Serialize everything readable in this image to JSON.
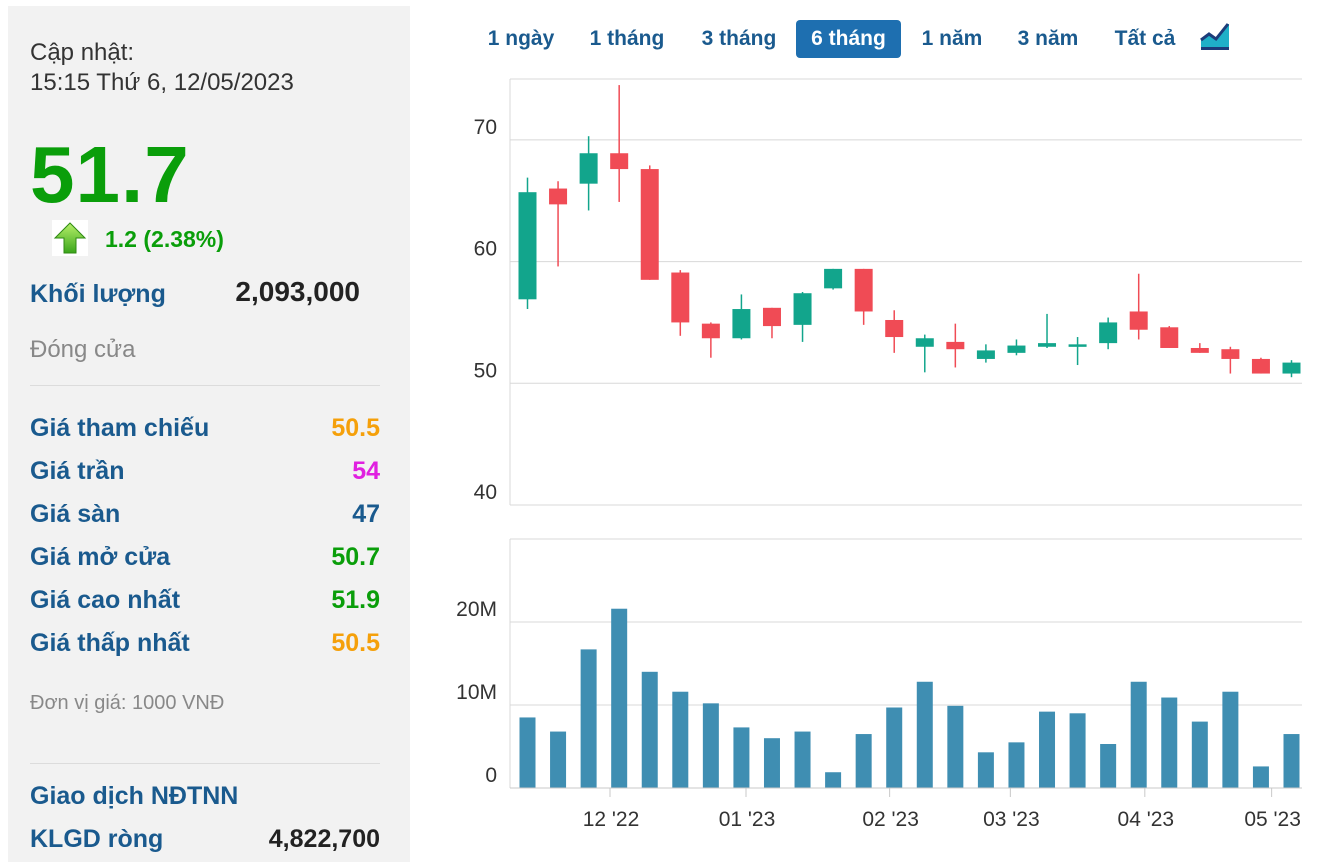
{
  "panel": {
    "updated_label": "Cập nhật:",
    "updated_time": "15:15 Thứ 6, 12/05/2023",
    "price": "51.7",
    "change": "1.2 (2.38%)",
    "volume_label": "Khối lượng",
    "volume_value": "2,093,000",
    "status": "Đóng cửa",
    "rows": [
      {
        "label": "Giá tham chiếu",
        "value": "50.5",
        "color": "#f5a00a"
      },
      {
        "label": "Giá trần",
        "value": "54",
        "color": "#e020e0"
      },
      {
        "label": "Giá sàn",
        "value": "47",
        "color": "#1a5a8e"
      },
      {
        "label": "Giá mở cửa",
        "value": "50.7",
        "color": "#0a9e0a"
      },
      {
        "label": "Giá cao nhất",
        "value": "51.9",
        "color": "#0a9e0a"
      },
      {
        "label": "Giá thấp nhất",
        "value": "50.5",
        "color": "#f5a00a"
      }
    ],
    "unit_note": "Đơn vị giá: 1000 VNĐ",
    "foreign_title": "Giao dịch NĐTNN",
    "net_label": "KLGD ròng",
    "net_value": "4,822,700"
  },
  "tabs": {
    "items": [
      "1 ngày",
      "1 tháng",
      "3 tháng",
      "6 tháng",
      "1 năm",
      "3 năm",
      "Tất cả"
    ],
    "active": "6 tháng",
    "chart_type_icon": "area-chart-icon"
  },
  "colors": {
    "up": "#12a58c",
    "down": "#f04b55",
    "volume": "#3f8eb2",
    "accent": "#1e6fb0"
  },
  "chart_data": [
    {
      "type": "candlestick",
      "ylim": [
        40,
        75
      ],
      "yticks": [
        40,
        50,
        60,
        70
      ],
      "x_ticks": [
        {
          "label": "12 '22",
          "index": 2.7
        },
        {
          "label": "01 '23",
          "index": 7.15
        },
        {
          "label": "02 '23",
          "index": 11.85
        },
        {
          "label": "03 '23",
          "index": 15.8
        },
        {
          "label": "04 '23",
          "index": 20.2
        },
        {
          "label": "05 '23",
          "index": 24.35
        }
      ],
      "candles": [
        {
          "o": 56.9,
          "h": 66.9,
          "l": 56.1,
          "c": 65.7
        },
        {
          "o": 66.0,
          "h": 66.6,
          "l": 59.6,
          "c": 64.7
        },
        {
          "o": 66.4,
          "h": 70.3,
          "l": 64.2,
          "c": 68.9
        },
        {
          "o": 68.9,
          "h": 74.5,
          "l": 64.9,
          "c": 67.6
        },
        {
          "o": 67.6,
          "h": 67.9,
          "l": 58.5,
          "c": 58.5
        },
        {
          "o": 59.1,
          "h": 59.3,
          "l": 53.9,
          "c": 55.0
        },
        {
          "o": 54.9,
          "h": 55.0,
          "l": 52.1,
          "c": 53.7
        },
        {
          "o": 53.7,
          "h": 57.3,
          "l": 53.6,
          "c": 56.1
        },
        {
          "o": 56.2,
          "h": 56.2,
          "l": 53.7,
          "c": 54.7
        },
        {
          "o": 54.8,
          "h": 57.5,
          "l": 53.4,
          "c": 57.4
        },
        {
          "o": 57.8,
          "h": 59.4,
          "l": 57.7,
          "c": 59.4
        },
        {
          "o": 59.4,
          "h": 59.4,
          "l": 54.8,
          "c": 55.9
        },
        {
          "o": 55.2,
          "h": 56.0,
          "l": 52.5,
          "c": 53.8
        },
        {
          "o": 53.0,
          "h": 54.0,
          "l": 50.9,
          "c": 53.7
        },
        {
          "o": 53.4,
          "h": 54.9,
          "l": 51.3,
          "c": 52.8
        },
        {
          "o": 52.0,
          "h": 53.2,
          "l": 51.7,
          "c": 52.7
        },
        {
          "o": 52.5,
          "h": 53.6,
          "l": 52.3,
          "c": 53.1
        },
        {
          "o": 53.0,
          "h": 55.7,
          "l": 52.9,
          "c": 53.3
        },
        {
          "o": 53.0,
          "h": 53.8,
          "l": 51.5,
          "c": 53.2
        },
        {
          "o": 53.3,
          "h": 55.4,
          "l": 52.8,
          "c": 55.0
        },
        {
          "o": 55.9,
          "h": 59.0,
          "l": 53.6,
          "c": 54.4
        },
        {
          "o": 54.6,
          "h": 54.7,
          "l": 52.9,
          "c": 52.9
        },
        {
          "o": 52.9,
          "h": 53.3,
          "l": 52.5,
          "c": 52.5
        },
        {
          "o": 52.8,
          "h": 53.0,
          "l": 50.8,
          "c": 52.0
        },
        {
          "o": 52.0,
          "h": 52.1,
          "l": 50.8,
          "c": 50.8
        },
        {
          "o": 50.8,
          "h": 51.9,
          "l": 50.5,
          "c": 51.7
        }
      ]
    },
    {
      "type": "bar",
      "ylim": [
        0,
        30
      ],
      "yticks": [
        {
          "value": 0,
          "label": "0"
        },
        {
          "value": 10,
          "label": "10M"
        },
        {
          "value": 20,
          "label": "20M"
        }
      ],
      "unit": "M",
      "values": [
        8.5,
        6.8,
        16.7,
        21.6,
        14.0,
        11.6,
        10.2,
        7.3,
        6.0,
        6.8,
        1.9,
        6.5,
        9.7,
        12.8,
        9.9,
        4.3,
        5.5,
        9.2,
        9.0,
        5.3,
        12.8,
        10.9,
        8.0,
        11.6,
        2.6,
        6.5
      ]
    }
  ]
}
